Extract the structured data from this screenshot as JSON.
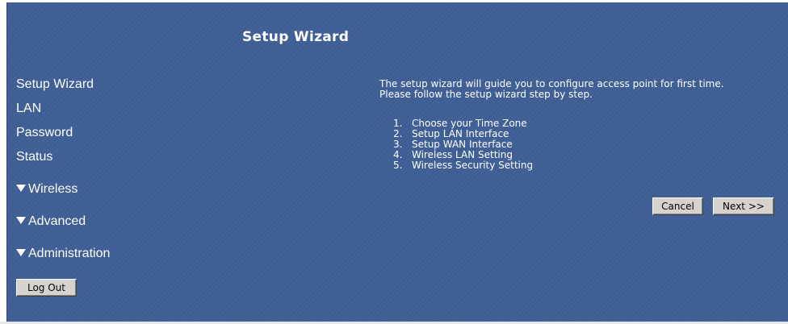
{
  "header": {
    "title": "Setup Wizard"
  },
  "sidebar": {
    "items": [
      {
        "label": "Setup Wizard",
        "expandable": false
      },
      {
        "label": "LAN",
        "expandable": false
      },
      {
        "label": "Password",
        "expandable": false
      },
      {
        "label": "Status",
        "expandable": false
      },
      {
        "label": "Wireless",
        "expandable": true,
        "icon": "triangle-down-icon"
      },
      {
        "label": "Advanced",
        "expandable": true,
        "icon": "triangle-down-icon"
      },
      {
        "label": "Administration",
        "expandable": true,
        "icon": "triangle-down-icon"
      }
    ],
    "logout_label": "Log Out"
  },
  "main": {
    "intro_line1": "The setup wizard will guide you to configure access point for first time.",
    "intro_line2": "Please follow the setup wizard step by step.",
    "steps": [
      {
        "num": "1.",
        "label": "Choose your Time Zone"
      },
      {
        "num": "2.",
        "label": "Setup LAN Interface"
      },
      {
        "num": "3.",
        "label": "Setup WAN Interface"
      },
      {
        "num": "4.",
        "label": "Wireless LAN Setting"
      },
      {
        "num": "5.",
        "label": "Wireless Security Setting"
      }
    ],
    "cancel_label": "Cancel",
    "next_label": "Next >>"
  },
  "colors": {
    "panel_background": "#3e5f96",
    "text": "#ffffff",
    "button_face": "#d6d3ce"
  }
}
